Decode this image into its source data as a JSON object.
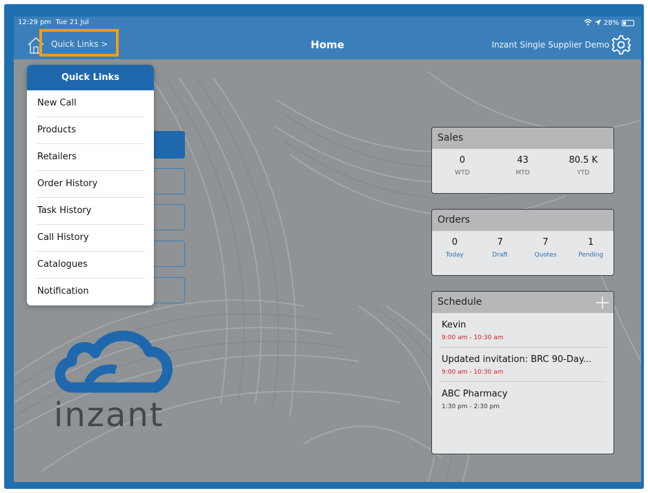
{
  "status_bar": {
    "time": "12:29 pm",
    "date": "Tue 21 Jul",
    "battery": "28%",
    "battery_level": 0.28
  },
  "header": {
    "quick_links_label": "Quick Links >",
    "title": "Home",
    "supplier": "Inzant Single Supplier Demo"
  },
  "quick_links_menu": {
    "title": "Quick Links",
    "items": [
      {
        "label": "New Call"
      },
      {
        "label": "Products"
      },
      {
        "label": "Retailers"
      },
      {
        "label": "Order History"
      },
      {
        "label": "Task History"
      },
      {
        "label": "Call History"
      },
      {
        "label": "Catalogues"
      },
      {
        "label": "Notification"
      }
    ]
  },
  "sales": {
    "title": "Sales",
    "stats": [
      {
        "value": "0",
        "label": "WTD"
      },
      {
        "value": "43",
        "label": "MTD"
      },
      {
        "value": "80.5 K",
        "label": "YTD"
      }
    ]
  },
  "orders": {
    "title": "Orders",
    "stats": [
      {
        "value": "0",
        "label": "Today"
      },
      {
        "value": "7",
        "label": "Draft"
      },
      {
        "value": "7",
        "label": "Quotes"
      },
      {
        "value": "1",
        "label": "Pending"
      }
    ]
  },
  "schedule": {
    "title": "Schedule",
    "items": [
      {
        "title": "Kevin",
        "time": "9:00 am - 10:30 am"
      },
      {
        "title": "Updated invitation: BRC 90-Day...",
        "time": "9:00 am - 10:30 am"
      },
      {
        "title": "ABC Pharmacy",
        "time": "1:30 pm - 2:30 pm"
      }
    ]
  },
  "logo": {
    "text": "inzant"
  },
  "colors": {
    "accent": "#1f68ad",
    "header": "#3a7fba",
    "highlight": "#f59d12",
    "time_red": "#d1202a"
  }
}
